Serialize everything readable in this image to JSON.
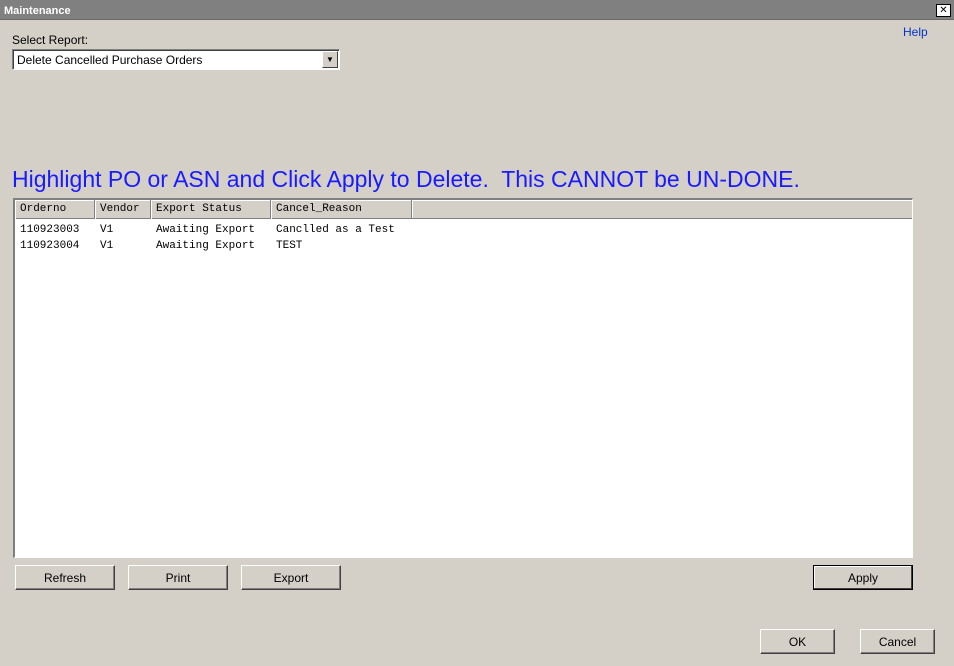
{
  "window": {
    "title": "Maintenance",
    "close_glyph": "✕"
  },
  "help_label": "Help",
  "report": {
    "label": "Select Report:",
    "selected": "Delete Cancelled Purchase Orders",
    "arrow_glyph": "▼"
  },
  "instruction": "Highlight PO or ASN and Click Apply to Delete.  This CANNOT be UN-DONE.",
  "grid": {
    "columns": [
      "Orderno",
      "Vendor",
      "Export Status",
      "Cancel_Reason"
    ],
    "rows": [
      [
        "110923003",
        "V1",
        "Awaiting Export",
        "Canclled as a Test"
      ],
      [
        "110923004",
        "V1",
        "Awaiting Export",
        "TEST"
      ]
    ]
  },
  "buttons": {
    "refresh": "Refresh",
    "print": "Print",
    "export": "Export",
    "apply": "Apply",
    "ok": "OK",
    "cancel": "Cancel"
  }
}
